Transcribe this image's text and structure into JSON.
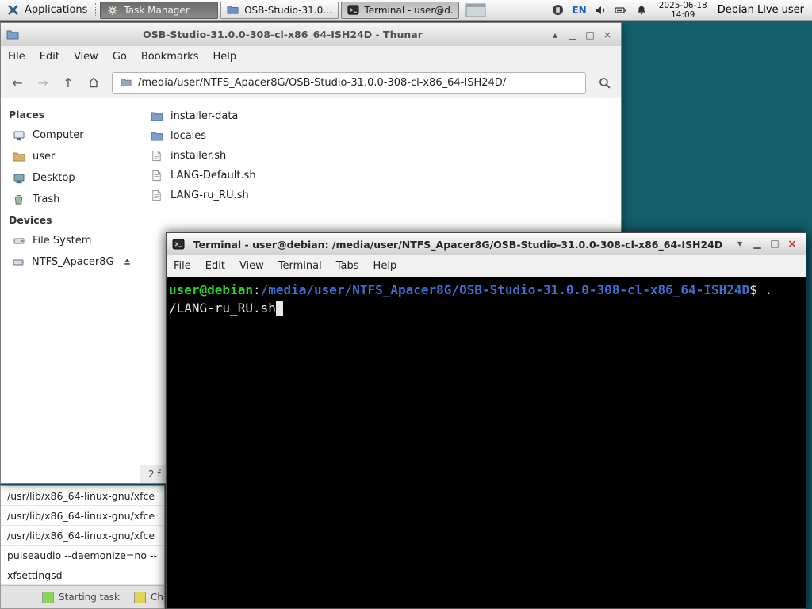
{
  "colors": {
    "desktop": "#135f6b",
    "term-green": "#33cc33",
    "term-blue": "#3f6fd4",
    "lang-blue": "#1e5bb8",
    "legend-green": "#8ad45c",
    "legend-yellow": "#e0d455"
  },
  "panel": {
    "applications": "Applications",
    "tasks": [
      {
        "label": "Task Manager"
      },
      {
        "label": "OSB-Studio-31.0...."
      },
      {
        "label": "Terminal - user@d..."
      }
    ],
    "language": "EN",
    "date": "2025-06-18",
    "time": "14:09",
    "user": "Debian Live user"
  },
  "thunar": {
    "title": "OSB-Studio-31.0.0-308-cl-x86_64-ISH24D - Thunar",
    "menu": [
      "File",
      "Edit",
      "View",
      "Go",
      "Bookmarks",
      "Help"
    ],
    "nav": {
      "back": "←",
      "forward": "→",
      "up": "↑"
    },
    "path": "/media/user/NTFS_Apacer8G/OSB-Studio-31.0.0-308-cl-x86_64-ISH24D/",
    "places_header": "Places",
    "places": [
      "Computer",
      "user",
      "Desktop",
      "Trash"
    ],
    "devices_header": "Devices",
    "devices": [
      "File System",
      "NTFS_Apacer8G"
    ],
    "files": [
      "installer-data",
      "locales",
      "installer.sh",
      "LANG-Default.sh",
      "LANG-ru_RU.sh"
    ],
    "status": "2 f",
    "controls": {
      "shade": "▴",
      "min": "▁",
      "max": "□",
      "close": "×"
    }
  },
  "terminal": {
    "title": "Terminal - user@debian: /media/user/NTFS_Apacer8G/OSB-Studio-31.0.0-308-cl-x86_64-ISH24D",
    "menu": [
      "File",
      "Edit",
      "View",
      "Terminal",
      "Tabs",
      "Help"
    ],
    "prompt_user": "user@debian",
    "prompt_colon": ":",
    "prompt_path": "/media/user/NTFS_Apacer8G/OSB-Studio-31.0.0-308-cl-x86_64-ISH24D",
    "prompt_tail": "$ .",
    "line2": "/LANG-ru_RU.sh",
    "controls": {
      "shade": "▾",
      "min": "▁",
      "max": "□",
      "close": "×"
    }
  },
  "taskmanager": {
    "rows": [
      "/usr/lib/x86_64-linux-gnu/xfce",
      "/usr/lib/x86_64-linux-gnu/xfce",
      "/usr/lib/x86_64-linux-gnu/xfce",
      "pulseaudio --daemonize=no --",
      "xfsettingsd"
    ],
    "legend": [
      {
        "label": "Starting task"
      },
      {
        "label": "Char"
      }
    ]
  }
}
